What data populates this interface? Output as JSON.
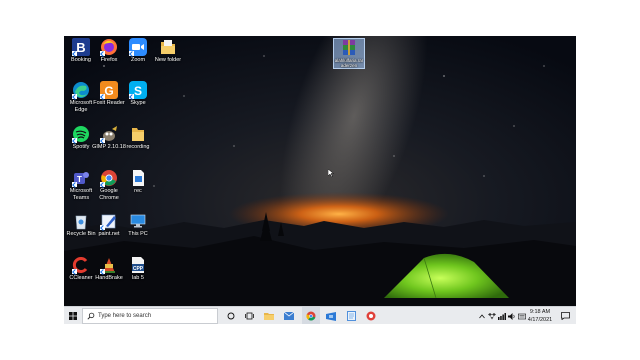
{
  "desktop": {
    "icons": [
      {
        "label": "Booking",
        "name": "booking-icon"
      },
      {
        "label": "Firefox",
        "name": "firefox-icon"
      },
      {
        "label": "Zoom",
        "name": "zoom-icon"
      },
      {
        "label": "New folder",
        "name": "folder-icon"
      },
      {
        "label": "Microsoft Edge",
        "name": "edge-icon"
      },
      {
        "label": "Foxit Reader",
        "name": "foxit-reader-icon"
      },
      {
        "label": "Skype",
        "name": "skype-icon"
      },
      {
        "label": "Spotify",
        "name": "spotify-icon"
      },
      {
        "label": "GIMP 2.10.18",
        "name": "gimp-icon"
      },
      {
        "label": "recording",
        "name": "folder-icon"
      },
      {
        "label": "Microsoft Teams",
        "name": "teams-icon"
      },
      {
        "label": "Google Chrome",
        "name": "chrome-icon"
      },
      {
        "label": "rec",
        "name": "document-icon"
      },
      {
        "label": "Recycle Bin",
        "name": "recycle-bin-icon"
      },
      {
        "label": "paint.net",
        "name": "paintnet-icon"
      },
      {
        "label": "This PC",
        "name": "this-pc-icon"
      },
      {
        "label": "CCleaner",
        "name": "ccleaner-icon"
      },
      {
        "label": "HandBrake",
        "name": "handbrake-icon"
      },
      {
        "label": "lab 5",
        "name": "cpp-file-icon"
      }
    ],
    "selected_file": {
      "label": "alahlulfaria.rar",
      "label_line2": "aderzen",
      "name": "winrar-archive-icon"
    }
  },
  "taskbar": {
    "search_placeholder": "Type here to search",
    "time": "9:18 AM",
    "date": "4/17/2021"
  }
}
